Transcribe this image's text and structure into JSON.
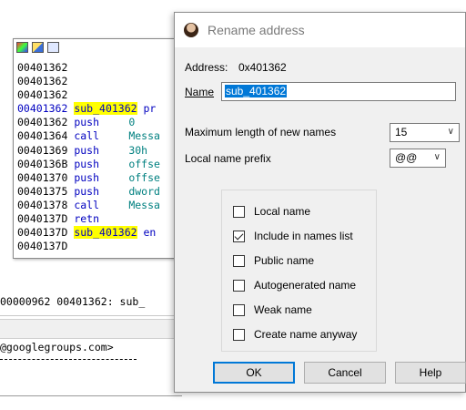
{
  "background": {
    "code_lines": [
      {
        "addr": "00401362",
        "mnemonic": "",
        "operand": "",
        "label": "",
        "after": ""
      },
      {
        "addr": "00401362",
        "mnemonic": "",
        "operand": "",
        "label": "",
        "after": ""
      },
      {
        "addr": "00401362",
        "mnemonic": "",
        "operand": "",
        "label": "",
        "after": ""
      },
      {
        "addr": "00401362",
        "mnemonic": "",
        "operand": "",
        "label": "sub_401362",
        "after": " pr"
      },
      {
        "addr": "00401362",
        "mnemonic": "push",
        "operand": "0",
        "label": "",
        "after": ""
      },
      {
        "addr": "00401364",
        "mnemonic": "call",
        "operand": "Messa",
        "label": "",
        "after": ""
      },
      {
        "addr": "00401369",
        "mnemonic": "push",
        "operand": "30h",
        "label": "",
        "after": ""
      },
      {
        "addr": "0040136B",
        "mnemonic": "push",
        "operand": "offse",
        "label": "",
        "after": ""
      },
      {
        "addr": "00401370",
        "mnemonic": "push",
        "operand": "offse",
        "label": "",
        "after": ""
      },
      {
        "addr": "00401375",
        "mnemonic": "push",
        "operand": "dword",
        "label": "",
        "after": ""
      },
      {
        "addr": "00401378",
        "mnemonic": "call",
        "operand": "Messa",
        "label": "",
        "after": ""
      },
      {
        "addr": "0040137D",
        "mnemonic": "retn",
        "operand": "",
        "label": "",
        "after": ""
      },
      {
        "addr": "0040137D",
        "mnemonic": "",
        "operand": "",
        "label": "sub_401362",
        "after": " en"
      },
      {
        "addr": "0040137D",
        "mnemonic": "",
        "operand": "",
        "label": "",
        "after": ""
      }
    ],
    "status_line": "00000962 00401362: sub_",
    "output_text": "@googlegroups.com>"
  },
  "dialog": {
    "title": "Rename address",
    "address_label": "Address:",
    "address_value": "0x401362",
    "name_label": "Name",
    "name_value": "sub_401362",
    "maxlen_label": "Maximum length of new names",
    "maxlen_value": "15",
    "prefix_label": "Local name prefix",
    "prefix_value": "@@",
    "options": [
      {
        "label": "Local name",
        "checked": false
      },
      {
        "label": "Include in names list",
        "checked": true
      },
      {
        "label": "Public name",
        "checked": false
      },
      {
        "label": "Autogenerated name",
        "checked": false
      },
      {
        "label": "Weak name",
        "checked": false
      },
      {
        "label": "Create name anyway",
        "checked": false
      }
    ],
    "ok_label": "OK",
    "cancel_label": "Cancel",
    "help_label": "Help"
  }
}
